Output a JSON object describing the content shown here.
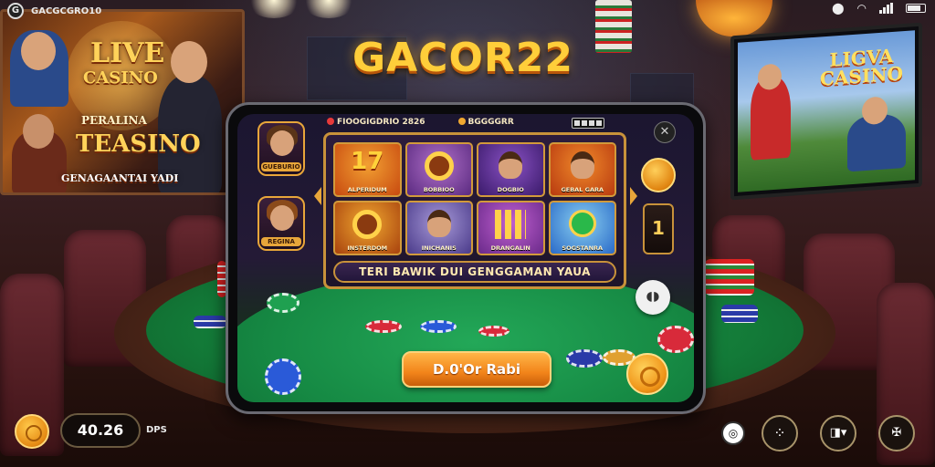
{
  "system_bar": {
    "app_name": "GACGCGRO10",
    "logo_glyph": "G",
    "icons": [
      "location-pin-icon",
      "wifi-icon",
      "signal-icon",
      "battery-icon"
    ]
  },
  "brand": {
    "title": "GACOR22"
  },
  "posters": {
    "left": {
      "title_line1": "LIVE",
      "title_line2": "CASINO",
      "title_line3": "PERALINA",
      "title_line4": "TEASINO",
      "caption": "GENAGAANTAI YADI"
    },
    "right_tv": {
      "title_line1": "LIGVA",
      "title_line2": "CASINO"
    }
  },
  "phone": {
    "status": {
      "left_label": "FIOOGIGDRIO 2826",
      "right_label": "BGGGGRR"
    },
    "side_avatars": [
      {
        "name": "GUEBURIO"
      },
      {
        "name": "REGINA"
      }
    ],
    "games": [
      {
        "label": "ALPERIDUM",
        "art": "17",
        "color_a": "#c84a10",
        "color_b": "#f2a032"
      },
      {
        "label": "BOBBIOO",
        "art": "wheel",
        "color_a": "#5a2a80",
        "color_b": "#b070c8"
      },
      {
        "label": "DOGBIO",
        "art": "queen",
        "color_a": "#3a1a6a",
        "color_b": "#8a52c4"
      },
      {
        "label": "GEBAL GARA",
        "art": "king",
        "color_a": "#b83a10",
        "color_b": "#f08a2a"
      },
      {
        "label": "INSTERDOM",
        "art": "ring",
        "color_a": "#a8420e",
        "color_b": "#f0a830"
      },
      {
        "label": "INICHANIS",
        "art": "face",
        "color_a": "#4a3a8a",
        "color_b": "#a89ad8"
      },
      {
        "label": "DRANGALIN",
        "art": "bars",
        "color_a": "#6a2a8a",
        "color_b": "#c060d0"
      },
      {
        "label": "SOGSTANRA",
        "art": "ball",
        "color_a": "#2a6ac8",
        "color_b": "#8ad0f0"
      }
    ],
    "banner": "TERI BAWIK DUI GENGGAMAN YAUA",
    "tall_button_label": "1",
    "mute_icon": "waveform-icon",
    "cta_label": "D.0'Or Rabi"
  },
  "bottom_bar": {
    "balance": "40.26",
    "unit": "DPS",
    "buttons": [
      "target-icon",
      "chips-icon",
      "menu-grid-icon",
      "chip-logo-icon"
    ]
  },
  "colors": {
    "brand_gold": "#ffce3a",
    "felt_green": "#168a44",
    "accent_orange": "#f2841a"
  }
}
